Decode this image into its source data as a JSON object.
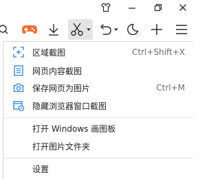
{
  "colors": {
    "accent": "#2a7fd4",
    "game_icon": "#f26c2b",
    "icon_dark": "#2b2b2b",
    "shortcut": "#6b6b6b"
  },
  "titlebar": {
    "icons": [
      "shirt-skin-icon",
      "minimize-icon",
      "restore-icon",
      "close-icon"
    ]
  },
  "toolbar": {
    "icons": [
      "search-icon-partial",
      "gamepad-icon",
      "download-icon",
      "scissors-icon",
      "dropdown-arrow-icon",
      "undo-icon",
      "dropdown-arrow-icon",
      "night-mode-icon",
      "new-tab-plus-icon",
      "menu-icon"
    ]
  },
  "menu": {
    "items": [
      {
        "label": "区域截图",
        "shortcut": "Ctrl+Shift+X",
        "icon": "region-capture-icon"
      },
      {
        "label": "网页内容截图",
        "shortcut": "",
        "icon": "page-content-capture-icon"
      },
      {
        "label": "保存网页为图片",
        "shortcut": "Ctrl+M",
        "icon": "camera-icon"
      },
      {
        "label": "隐藏浏览器窗口截图",
        "shortcut": "",
        "icon": "hidden-window-capture-icon"
      },
      {
        "label": "打开 Windows 画图板",
        "shortcut": ""
      },
      {
        "label": "打开图片文件夹",
        "shortcut": ""
      },
      {
        "label": "设置",
        "shortcut": ""
      }
    ]
  }
}
